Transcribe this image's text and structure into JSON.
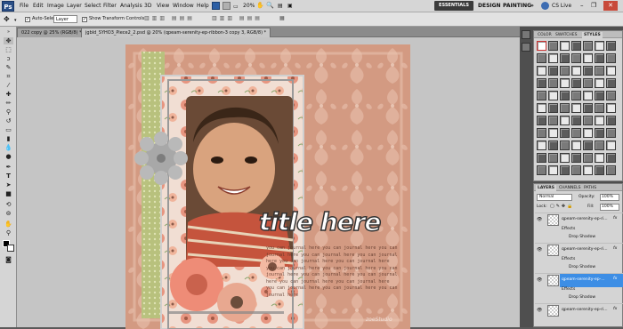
{
  "menubar": {
    "logo": "Ps",
    "items": [
      "File",
      "Edit",
      "Image",
      "Layer",
      "Select",
      "Filter",
      "Analysis",
      "3D",
      "View",
      "Window",
      "Help"
    ],
    "zoom": "20%",
    "workspaces": [
      "ESSENTIALS",
      "DESIGN",
      "PAINTING"
    ],
    "more": "»",
    "cslive": "CS Live"
  },
  "options": {
    "auto_select_label": "Auto-Select:",
    "auto_select_value": "Layer",
    "transform_label": "Show Transform Controls"
  },
  "documents": {
    "tab1": "022 copy @ 25% (RGB/8) *",
    "tab2": "jgbld_SYHO3_Piece2_2.psd @ 20% (qpeam-serenity-ep-ribbon-3 copy 3, RGB/8) *"
  },
  "canvas": {
    "title_text": "title here",
    "journal_text": "you can journal here you can journal here you can journal here you can journal here you can journal here you can journal here you can journal here you can journal here you can journal here you can journal here you can journal here you can journal here you can journal here you can journal here you can journal here you can journal here you can journal here",
    "watermark": "zoeStudio"
  },
  "styles_panel": {
    "tabs": [
      "COLOR",
      "SWATCHES",
      "STYLES"
    ]
  },
  "layers_panel": {
    "tabs": [
      "LAYERS",
      "CHANNELS",
      "PATHS"
    ],
    "blend_mode": "Normal",
    "opacity_label": "Opacity:",
    "opacity_value": "100%",
    "lock_label": "Lock:",
    "fill_label": "Fill:",
    "fill_value": "100%",
    "layers": [
      {
        "name": "qpeam-serenity-ep-ri...",
        "effects": "Effects",
        "effect": "Drop Shadow"
      },
      {
        "name": "qpeam-serenity-ep-ri...",
        "effects": "Effects",
        "effect": "Drop Shadow"
      },
      {
        "name": "qpeam-serenity-ep-...",
        "effects": "Effects",
        "effect": "Drop Shadow",
        "selected": true
      },
      {
        "name": "qpeam-serenity-ep-ri..."
      }
    ]
  }
}
